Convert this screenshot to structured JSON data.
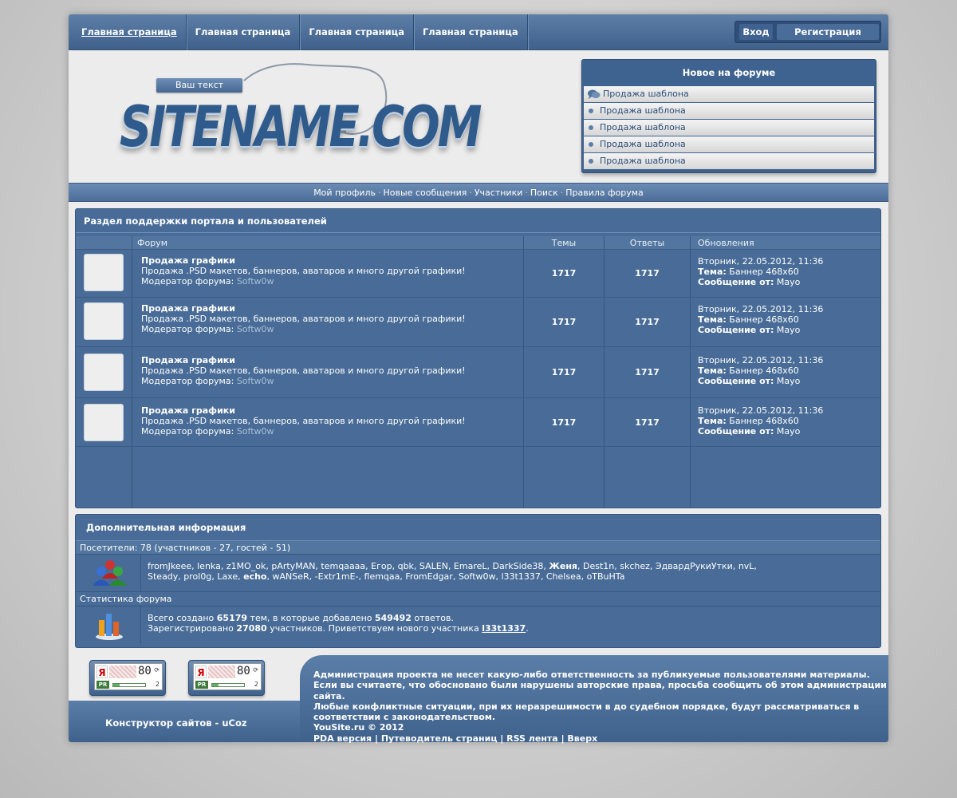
{
  "nav": {
    "items": [
      "Главная страница",
      "Главная страница",
      "Главная страница",
      "Главная страница"
    ],
    "login": "Вход",
    "register": "Регистрация"
  },
  "logo": {
    "tag": "Ваш текст",
    "title": "SITENAME.COM"
  },
  "new_on_forum": {
    "title": "Новое на форуме",
    "items": [
      "Продажа шаблона",
      "Продажа шаблона",
      "Продажа шаблона",
      "Продажа шаблона",
      "Продажа шаблона"
    ]
  },
  "subnav": {
    "items": [
      "Мой профиль",
      "Новые сообщения",
      "Участники",
      "Поиск",
      "Правила форума"
    ],
    "separator": "·"
  },
  "forum_section": {
    "title": "Раздел поддержки портала и пользователей",
    "headers": {
      "forum": "Форум",
      "topics": "Темы",
      "replies": "Ответы",
      "updates": "Обновления"
    },
    "rows": [
      {
        "name": "Продажа графики",
        "desc": "Продажа .PSD макетов, баннеров, аватаров и много другой графики!",
        "mod_label": "Модератор форума:",
        "mod": "Softw0w",
        "topics": "1717",
        "replies": "1717",
        "date": "Вторник, 22.05.2012, 11:36",
        "topic_label": "Тема:",
        "topic": "Баннер 468x60",
        "msg_label": "Сообщение от:",
        "author": "Mayo"
      },
      {
        "name": "Продажа графики",
        "desc": "Продажа .PSD макетов, баннеров, аватаров и много другой графики!",
        "mod_label": "Модератор форума:",
        "mod": "Softw0w",
        "topics": "1717",
        "replies": "1717",
        "date": "Вторник, 22.05.2012, 11:36",
        "topic_label": "Тема:",
        "topic": "Баннер 468x60",
        "msg_label": "Сообщение от:",
        "author": "Mayo"
      },
      {
        "name": "Продажа графики",
        "desc": "Продажа .PSD макетов, баннеров, аватаров и много другой графики!",
        "mod_label": "Модератор форума:",
        "mod": "Softw0w",
        "topics": "1717",
        "replies": "1717",
        "date": "Вторник, 22.05.2012, 11:36",
        "topic_label": "Тема:",
        "topic": "Баннер 468x60",
        "msg_label": "Сообщение от:",
        "author": "Mayo"
      },
      {
        "name": "Продажа графики",
        "desc": "Продажа .PSD макетов, баннеров, аватаров и много другой графики!",
        "mod_label": "Модератор форума:",
        "mod": "Softw0w",
        "topics": "1717",
        "replies": "1717",
        "date": "Вторник, 22.05.2012, 11:36",
        "topic_label": "Тема:",
        "topic": "Баннер 468x60",
        "msg_label": "Сообщение от:",
        "author": "Mayo"
      }
    ]
  },
  "info": {
    "title": "Дополнительная информация",
    "visitors_label": "Посетители: 78  (участников - 27, гостей - 51)",
    "users_line1_a": "fromJkeee, lenka, z1MO_ok, pArtyMAN, temqaaaa, Егор, qbk, SALEN, EmareL, DarkSide38, ",
    "users_line1_bold": "Женя",
    "users_line1_b": ", Dest1n, skchez, ЭдвардРукиУтки, nvL,",
    "users_line2_a": "Steady, prol0g, Laxe, ",
    "users_line2_bold": "echo",
    "users_line2_b": ", wANSeR, -Extr1mE-, flemqaa, FromEdgar, Softw0w, l33t1337, Chelsea, oTBuHTa",
    "stats_label": "Статистика форума",
    "stats_l1_a": "Всего создано ",
    "stats_l1_topics": "65179",
    "stats_l1_b": " тем, в которые добавлено ",
    "stats_l1_posts": "549492",
    "stats_l1_c": " ответов.",
    "stats_l2_a": "Зарегистрировано ",
    "stats_l2_users": "27080",
    "stats_l2_b": " участников. Приветствуем нового участника ",
    "stats_l2_new": "l33t1337",
    "stats_l2_c": "."
  },
  "footer": {
    "constructor": "Конструктор сайтов - uCoz",
    "legal_1": "Администрация проекта не несет какую-либо ответственность за публикуемые пользователями материалы.",
    "legal_2": "Если вы считаете, что обосновано были нарушены авторские права, просьба сообщить об этом администрации сайта.",
    "legal_3": "Любые конфликтные ситуации, при их неразрешимости в до судебном порядке, будут рассматриваться в",
    "legal_4": "соответствии с законодательством.",
    "copyright": "YouSite.ru © 2012",
    "links": [
      "PDA версия",
      "Путеводитель страниц",
      "RSS лента",
      "Вверх"
    ],
    "link_sep": " | ",
    "badges": [
      {
        "ya": "Я",
        "num": "80",
        "pr": "PR",
        "two": "2",
        "bar": 0.2
      },
      {
        "ya": "Я",
        "num": "80",
        "pr": "PR",
        "two": "2",
        "bar": 0.2
      }
    ]
  },
  "colors": {
    "accent": "#486c97",
    "header": "#4f729c",
    "link_muted": "#a9bfd8"
  }
}
